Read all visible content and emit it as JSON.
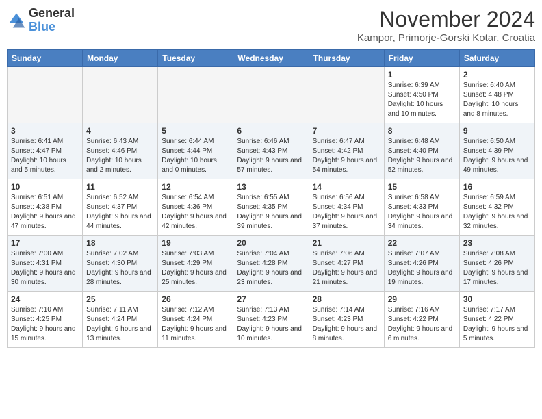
{
  "logo": {
    "general": "General",
    "blue": "Blue"
  },
  "header": {
    "title": "November 2024",
    "location": "Kampor, Primorje-Gorski Kotar, Croatia"
  },
  "columns": [
    "Sunday",
    "Monday",
    "Tuesday",
    "Wednesday",
    "Thursday",
    "Friday",
    "Saturday"
  ],
  "weeks": [
    [
      {
        "day": "",
        "info": ""
      },
      {
        "day": "",
        "info": ""
      },
      {
        "day": "",
        "info": ""
      },
      {
        "day": "",
        "info": ""
      },
      {
        "day": "",
        "info": ""
      },
      {
        "day": "1",
        "info": "Sunrise: 6:39 AM\nSunset: 4:50 PM\nDaylight: 10 hours and 10 minutes."
      },
      {
        "day": "2",
        "info": "Sunrise: 6:40 AM\nSunset: 4:48 PM\nDaylight: 10 hours and 8 minutes."
      }
    ],
    [
      {
        "day": "3",
        "info": "Sunrise: 6:41 AM\nSunset: 4:47 PM\nDaylight: 10 hours and 5 minutes."
      },
      {
        "day": "4",
        "info": "Sunrise: 6:43 AM\nSunset: 4:46 PM\nDaylight: 10 hours and 2 minutes."
      },
      {
        "day": "5",
        "info": "Sunrise: 6:44 AM\nSunset: 4:44 PM\nDaylight: 10 hours and 0 minutes."
      },
      {
        "day": "6",
        "info": "Sunrise: 6:46 AM\nSunset: 4:43 PM\nDaylight: 9 hours and 57 minutes."
      },
      {
        "day": "7",
        "info": "Sunrise: 6:47 AM\nSunset: 4:42 PM\nDaylight: 9 hours and 54 minutes."
      },
      {
        "day": "8",
        "info": "Sunrise: 6:48 AM\nSunset: 4:40 PM\nDaylight: 9 hours and 52 minutes."
      },
      {
        "day": "9",
        "info": "Sunrise: 6:50 AM\nSunset: 4:39 PM\nDaylight: 9 hours and 49 minutes."
      }
    ],
    [
      {
        "day": "10",
        "info": "Sunrise: 6:51 AM\nSunset: 4:38 PM\nDaylight: 9 hours and 47 minutes."
      },
      {
        "day": "11",
        "info": "Sunrise: 6:52 AM\nSunset: 4:37 PM\nDaylight: 9 hours and 44 minutes."
      },
      {
        "day": "12",
        "info": "Sunrise: 6:54 AM\nSunset: 4:36 PM\nDaylight: 9 hours and 42 minutes."
      },
      {
        "day": "13",
        "info": "Sunrise: 6:55 AM\nSunset: 4:35 PM\nDaylight: 9 hours and 39 minutes."
      },
      {
        "day": "14",
        "info": "Sunrise: 6:56 AM\nSunset: 4:34 PM\nDaylight: 9 hours and 37 minutes."
      },
      {
        "day": "15",
        "info": "Sunrise: 6:58 AM\nSunset: 4:33 PM\nDaylight: 9 hours and 34 minutes."
      },
      {
        "day": "16",
        "info": "Sunrise: 6:59 AM\nSunset: 4:32 PM\nDaylight: 9 hours and 32 minutes."
      }
    ],
    [
      {
        "day": "17",
        "info": "Sunrise: 7:00 AM\nSunset: 4:31 PM\nDaylight: 9 hours and 30 minutes."
      },
      {
        "day": "18",
        "info": "Sunrise: 7:02 AM\nSunset: 4:30 PM\nDaylight: 9 hours and 28 minutes."
      },
      {
        "day": "19",
        "info": "Sunrise: 7:03 AM\nSunset: 4:29 PM\nDaylight: 9 hours and 25 minutes."
      },
      {
        "day": "20",
        "info": "Sunrise: 7:04 AM\nSunset: 4:28 PM\nDaylight: 9 hours and 23 minutes."
      },
      {
        "day": "21",
        "info": "Sunrise: 7:06 AM\nSunset: 4:27 PM\nDaylight: 9 hours and 21 minutes."
      },
      {
        "day": "22",
        "info": "Sunrise: 7:07 AM\nSunset: 4:26 PM\nDaylight: 9 hours and 19 minutes."
      },
      {
        "day": "23",
        "info": "Sunrise: 7:08 AM\nSunset: 4:26 PM\nDaylight: 9 hours and 17 minutes."
      }
    ],
    [
      {
        "day": "24",
        "info": "Sunrise: 7:10 AM\nSunset: 4:25 PM\nDaylight: 9 hours and 15 minutes."
      },
      {
        "day": "25",
        "info": "Sunrise: 7:11 AM\nSunset: 4:24 PM\nDaylight: 9 hours and 13 minutes."
      },
      {
        "day": "26",
        "info": "Sunrise: 7:12 AM\nSunset: 4:24 PM\nDaylight: 9 hours and 11 minutes."
      },
      {
        "day": "27",
        "info": "Sunrise: 7:13 AM\nSunset: 4:23 PM\nDaylight: 9 hours and 10 minutes."
      },
      {
        "day": "28",
        "info": "Sunrise: 7:14 AM\nSunset: 4:23 PM\nDaylight: 9 hours and 8 minutes."
      },
      {
        "day": "29",
        "info": "Sunrise: 7:16 AM\nSunset: 4:22 PM\nDaylight: 9 hours and 6 minutes."
      },
      {
        "day": "30",
        "info": "Sunrise: 7:17 AM\nSunset: 4:22 PM\nDaylight: 9 hours and 5 minutes."
      }
    ]
  ]
}
